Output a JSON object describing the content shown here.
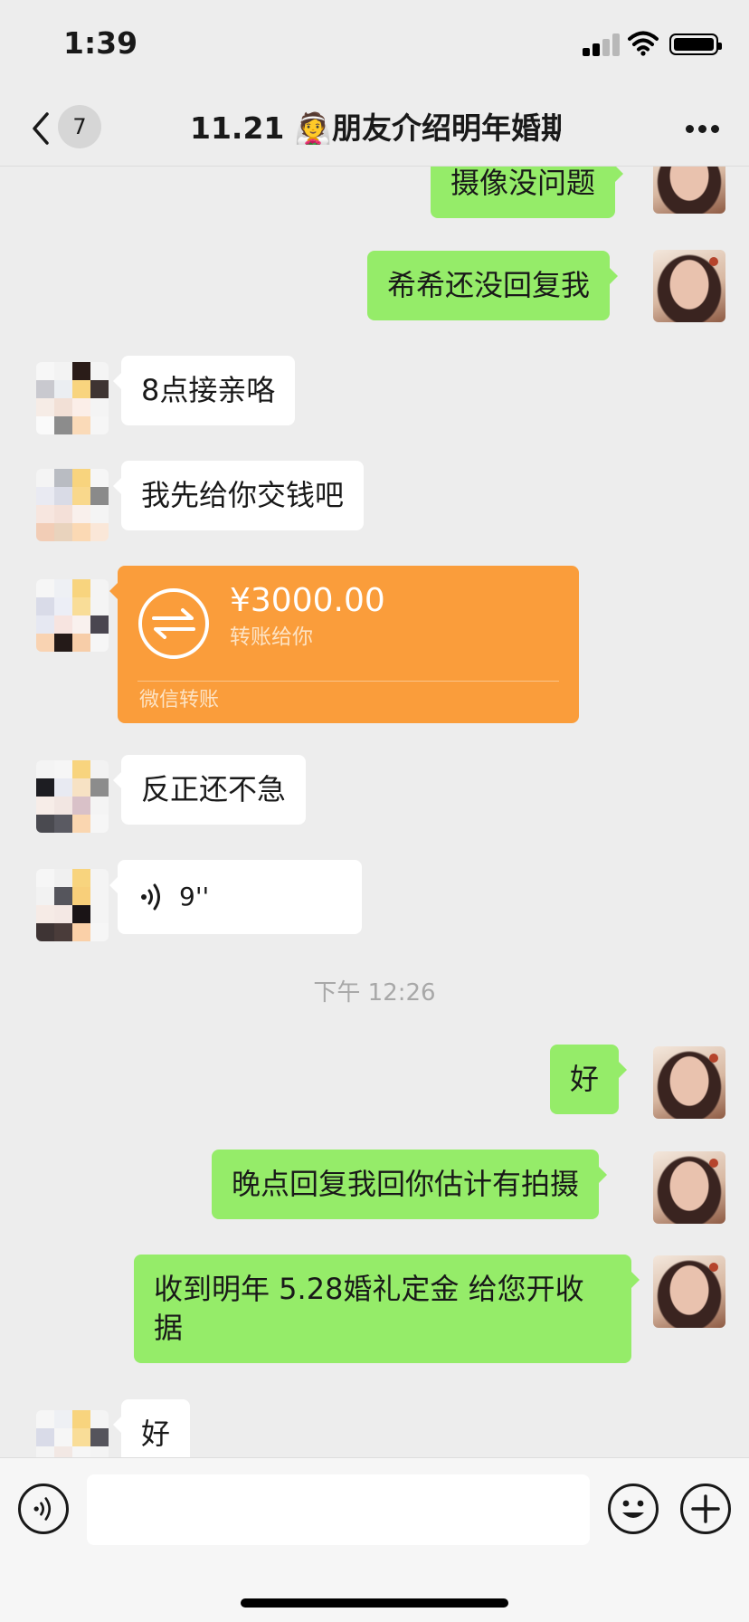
{
  "status_bar": {
    "time": "1:39"
  },
  "nav": {
    "unread_count": "7",
    "title": "11.21 👰朋友介绍明年婚期"
  },
  "messages": [
    {
      "side": "right",
      "text": "摄像没问题"
    },
    {
      "side": "right",
      "text": "希希还没回复我"
    },
    {
      "side": "left",
      "text": "8点接亲咯"
    },
    {
      "side": "left",
      "text": "我先给你交钱吧"
    },
    {
      "side": "left",
      "text": "反正还不急"
    },
    {
      "side": "right",
      "text": "好"
    },
    {
      "side": "right",
      "text": "晚点回复我回你估计有拍摄"
    },
    {
      "side": "right",
      "text": "收到明年 5.28婚礼定金 给您开收据"
    },
    {
      "side": "left",
      "text": "好"
    }
  ],
  "transfer": {
    "amount": "¥3000.00",
    "note": "转账给你",
    "source": "微信转账"
  },
  "voice": {
    "duration": "9''"
  },
  "timestamp": "下午 12:26",
  "input": {
    "value": ""
  },
  "colors": {
    "background": "#ededed",
    "bubble_right": "#95ec69",
    "bubble_left": "#ffffff",
    "transfer": "#fa9d3b"
  }
}
